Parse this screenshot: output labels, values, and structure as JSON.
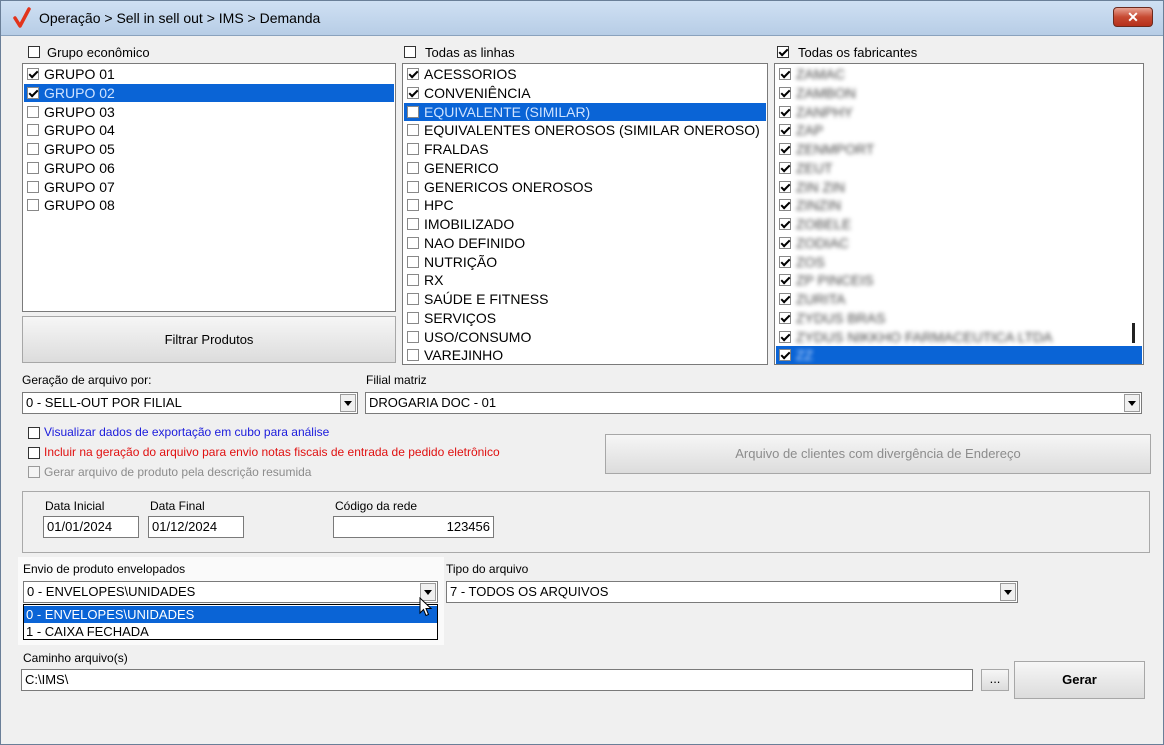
{
  "window": {
    "title": "Operação > Sell in sell out > IMS > Demanda",
    "close_label": "✕"
  },
  "grupo": {
    "header": "Grupo econômico",
    "header_checked": false,
    "items": [
      {
        "label": "GRUPO 01",
        "checked": true,
        "selected": false
      },
      {
        "label": "GRUPO 02",
        "checked": true,
        "selected": true
      },
      {
        "label": "GRUPO 03",
        "checked": false,
        "selected": false
      },
      {
        "label": "GRUPO 04",
        "checked": false,
        "selected": false
      },
      {
        "label": "GRUPO 05",
        "checked": false,
        "selected": false
      },
      {
        "label": "GRUPO 06",
        "checked": false,
        "selected": false
      },
      {
        "label": "GRUPO 07",
        "checked": false,
        "selected": false
      },
      {
        "label": "GRUPO 08",
        "checked": false,
        "selected": false
      }
    ],
    "filter_button": "Filtrar Produtos"
  },
  "linhas": {
    "header": "Todas as linhas",
    "header_checked": false,
    "items": [
      {
        "label": "ACESSORIOS",
        "checked": true,
        "selected": false
      },
      {
        "label": "CONVENIÊNCIA",
        "checked": true,
        "selected": false
      },
      {
        "label": "EQUIVALENTE (SIMILAR)",
        "checked": false,
        "selected": true
      },
      {
        "label": "EQUIVALENTES ONEROSOS (SIMILAR ONEROSO)",
        "checked": false,
        "selected": false
      },
      {
        "label": "FRALDAS",
        "checked": false,
        "selected": false
      },
      {
        "label": "GENERICO",
        "checked": false,
        "selected": false
      },
      {
        "label": "GENERICOS ONEROSOS",
        "checked": false,
        "selected": false
      },
      {
        "label": "HPC",
        "checked": false,
        "selected": false
      },
      {
        "label": "IMOBILIZADO",
        "checked": false,
        "selected": false
      },
      {
        "label": "NAO DEFINIDO",
        "checked": false,
        "selected": false
      },
      {
        "label": "NUTRIÇÃO",
        "checked": false,
        "selected": false
      },
      {
        "label": "RX",
        "checked": false,
        "selected": false
      },
      {
        "label": "SAÚDE E FITNESS",
        "checked": false,
        "selected": false
      },
      {
        "label": "SERVIÇOS",
        "checked": false,
        "selected": false
      },
      {
        "label": "USO/CONSUMO",
        "checked": false,
        "selected": false
      },
      {
        "label": "VAREJINHO",
        "checked": false,
        "selected": false
      }
    ]
  },
  "fabricantes": {
    "header": "Todas os fabricantes",
    "header_checked": true,
    "items": [
      {
        "label": "ZAMAC",
        "checked": true,
        "selected": false
      },
      {
        "label": "ZAMBON",
        "checked": true,
        "selected": false
      },
      {
        "label": "ZANPHY",
        "checked": true,
        "selected": false
      },
      {
        "label": "ZAP",
        "checked": true,
        "selected": false
      },
      {
        "label": "ZENMPORT",
        "checked": true,
        "selected": false
      },
      {
        "label": "ZEUT",
        "checked": true,
        "selected": false
      },
      {
        "label": "ZIN ZIN",
        "checked": true,
        "selected": false
      },
      {
        "label": "ZINZIN",
        "checked": true,
        "selected": false
      },
      {
        "label": "ZOBELE",
        "checked": true,
        "selected": false
      },
      {
        "label": "ZODIAC",
        "checked": true,
        "selected": false
      },
      {
        "label": "ZOS",
        "checked": true,
        "selected": false
      },
      {
        "label": "ZP PINCEIS",
        "checked": true,
        "selected": false
      },
      {
        "label": "ZURITA",
        "checked": true,
        "selected": false
      },
      {
        "label": "ZYDUS BRAS",
        "checked": true,
        "selected": false
      },
      {
        "label": "ZYDUS NIKKHO FARMACEUTICA LTDA",
        "checked": true,
        "selected": false
      },
      {
        "label": "ZZ",
        "checked": true,
        "selected": true
      }
    ]
  },
  "geracao": {
    "label": "Geração de arquivo por:",
    "value": "0 - SELL-OUT POR FILIAL"
  },
  "filial": {
    "label": "Filial matriz",
    "value": "DROGARIA DOC - 01"
  },
  "options": {
    "opt1": "Visualizar dados de exportação em cubo para análise",
    "opt2": "Incluir na geração do arquivo para envio notas fiscais de entrada de pedido eletrônico",
    "opt3": "Gerar arquivo de produto pela descrição resumida",
    "color_opt1": "#1a1adc",
    "color_opt2": "#e01010"
  },
  "divergencia_button": "Arquivo de clientes com divergência de Endereço",
  "datas": {
    "inicial_label": "Data Inicial",
    "inicial": "01/01/2024",
    "final_label": "Data Final",
    "final": "01/12/2024",
    "rede_label": "Código da rede",
    "rede": "123456"
  },
  "envio": {
    "label": "Envio de produto envelopados",
    "value": "0 - ENVELOPES\\UNIDADES",
    "options": [
      "0 - ENVELOPES\\UNIDADES",
      "1 - CAIXA FECHADA"
    ]
  },
  "tipo": {
    "label": "Tipo do arquivo",
    "value": "7 - TODOS OS ARQUIVOS"
  },
  "caminho": {
    "label": "Caminho arquivo(s)",
    "value": "C:\\IMS\\",
    "browse": "...",
    "gerar": "Gerar"
  }
}
